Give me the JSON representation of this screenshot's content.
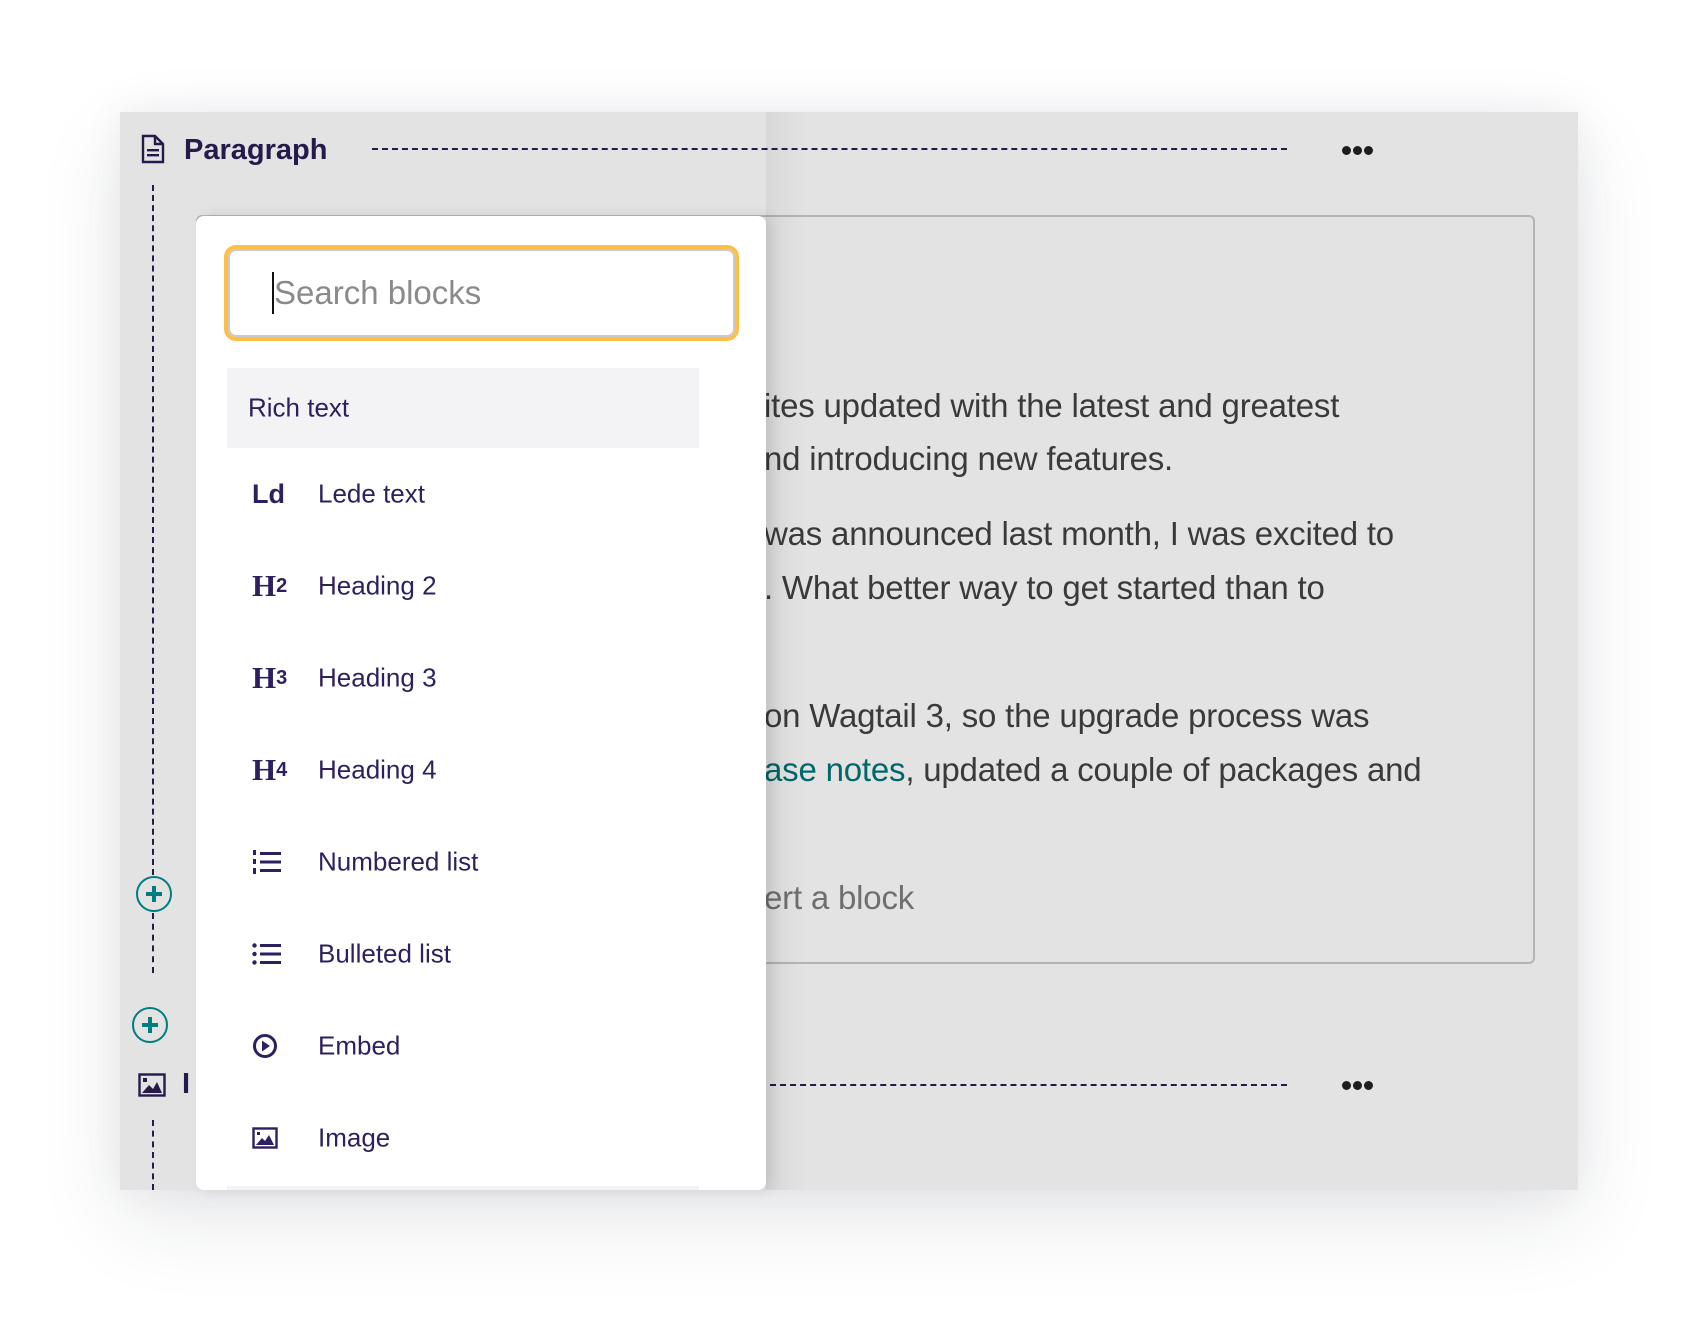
{
  "blocks": [
    {
      "type_icon": "document-icon",
      "title": "Paragraph",
      "more_label": "More options",
      "content_lines": [
        {
          "text": "ites updated with the latest and greatest"
        },
        {
          "text": "nd introducing new features."
        },
        {
          "text": " was announced last month, I was excited to"
        },
        {
          "text": ". What better way to get started than to"
        },
        {
          "text": " on Wagtail 3, so the upgrade process was"
        },
        {
          "link": "ase notes",
          "text": ", updated a couple of packages and"
        }
      ],
      "insert_placeholder": "ert a block"
    },
    {
      "type_icon": "image-icon",
      "title": "I"
    }
  ],
  "add_buttons": [
    {
      "label": "Insert block"
    },
    {
      "label": "Insert block"
    }
  ],
  "block_chooser": {
    "search": {
      "placeholder": "Search blocks",
      "value": ""
    },
    "group_label": "Rich text",
    "items": [
      {
        "icon": "lede-icon",
        "icon_text": "Ld",
        "label": "Lede text"
      },
      {
        "icon": "heading-2-icon",
        "icon_text": "H",
        "icon_sub": "2",
        "label": "Heading 2"
      },
      {
        "icon": "heading-3-icon",
        "icon_text": "H",
        "icon_sub": "3",
        "label": "Heading 3"
      },
      {
        "icon": "heading-4-icon",
        "icon_text": "H",
        "icon_sub": "4",
        "label": "Heading 4"
      },
      {
        "icon": "numbered-list-icon",
        "label": "Numbered list"
      },
      {
        "icon": "bulleted-list-icon",
        "label": "Bulleted list"
      },
      {
        "icon": "embed-icon",
        "label": "Embed"
      },
      {
        "icon": "image-icon",
        "label": "Image"
      }
    ]
  },
  "colors": {
    "panel_bg": "#e3e3e3",
    "primary_text": "#261a4b",
    "accent_teal": "#007d7e",
    "focus_outline": "#ffbf47",
    "link": "#00676a"
  }
}
